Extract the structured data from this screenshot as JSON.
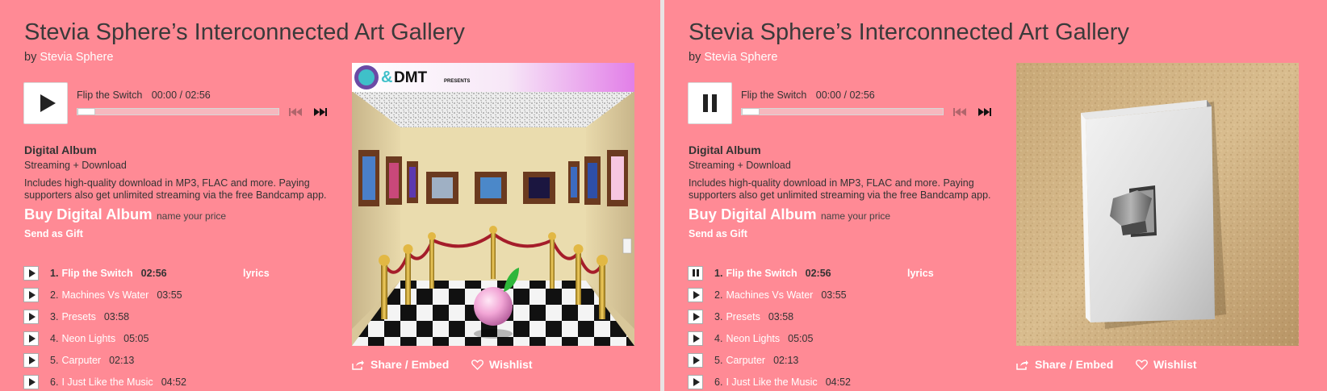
{
  "panels": [
    {
      "title": "Stevia Sphere’s Interconnected Art Gallery",
      "by_label": "by",
      "artist": "Stevia Sphere",
      "player": {
        "state": "paused",
        "track_title": "Flip the Switch",
        "time": "00:00 / 02:56",
        "progress": 0
      },
      "album": {
        "heading": "Digital Album",
        "sub": "Streaming + Download",
        "description": "Includes high-quality download in MP3, FLAC and more. Paying supporters also get unlimited streaming via the free Bandcamp app.",
        "buy_label": "Buy Digital Album",
        "price_label": "name your price",
        "gift_label": "Send as Gift"
      },
      "tracks": [
        {
          "num": "1.",
          "name": "Flip the Switch",
          "duration": "02:56",
          "lyrics": "lyrics"
        },
        {
          "num": "2.",
          "name": "Machines Vs Water",
          "duration": "03:55"
        },
        {
          "num": "3.",
          "name": "Presets",
          "duration": "03:58"
        },
        {
          "num": "4.",
          "name": "Neon Lights",
          "duration": "05:05"
        },
        {
          "num": "5.",
          "name": "Carputer",
          "duration": "02:13"
        },
        {
          "num": "6.",
          "name": "I Just Like the Music",
          "duration": "04:52"
        }
      ],
      "cover": {
        "type": "gallery",
        "banner_text": "&DMT",
        "banner_small": "PRESENTS"
      },
      "share_label": "Share / Embed",
      "wishlist_label": "Wishlist"
    },
    {
      "title": "Stevia Sphere’s Interconnected Art Gallery",
      "by_label": "by",
      "artist": "Stevia Sphere",
      "player": {
        "state": "playing",
        "track_title": "Flip the Switch",
        "time": "00:00 / 02:56",
        "progress": 0
      },
      "album": {
        "heading": "Digital Album",
        "sub": "Streaming + Download",
        "description": "Includes high-quality download in MP3, FLAC and more. Paying supporters also get unlimited streaming via the free Bandcamp app.",
        "buy_label": "Buy Digital Album",
        "price_label": "name your price",
        "gift_label": "Send as Gift"
      },
      "tracks": [
        {
          "num": "1.",
          "name": "Flip the Switch",
          "duration": "02:56",
          "lyrics": "lyrics"
        },
        {
          "num": "2.",
          "name": "Machines Vs Water",
          "duration": "03:55"
        },
        {
          "num": "3.",
          "name": "Presets",
          "duration": "03:58"
        },
        {
          "num": "4.",
          "name": "Neon Lights",
          "duration": "05:05"
        },
        {
          "num": "5.",
          "name": "Carputer",
          "duration": "02:13"
        },
        {
          "num": "6.",
          "name": "I Just Like the Music",
          "duration": "04:52"
        }
      ],
      "cover": {
        "type": "light-switch"
      },
      "share_label": "Share / Embed",
      "wishlist_label": "Wishlist"
    }
  ],
  "icons": {
    "play": "play-icon",
    "pause": "pause-icon",
    "prev": "skip-previous-icon",
    "next": "skip-next-icon",
    "share": "share-icon",
    "wishlist": "heart-icon"
  },
  "colors": {
    "background": "#ff8a95",
    "link": "#ffffff",
    "text": "#333333"
  }
}
